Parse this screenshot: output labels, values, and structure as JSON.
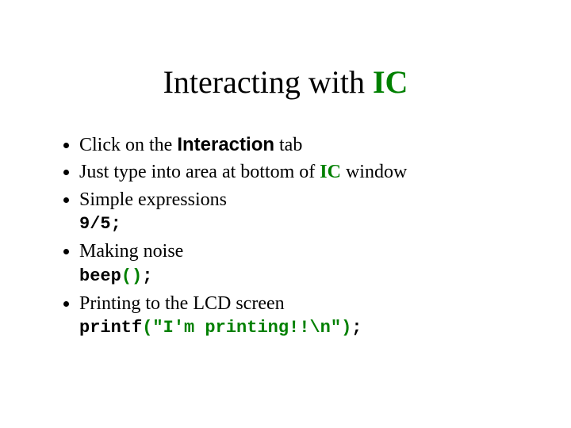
{
  "title": {
    "pre": "Interacting with ",
    "accent": "IC"
  },
  "b1": {
    "pre": "Click on the ",
    "strong": "Interaction",
    "post": " tab"
  },
  "b2a": "Just type into area at bottom of ",
  "b2b": "IC",
  "b2c": " window",
  "b3": "Simple expressions",
  "c1": "9/5;",
  "b4": "Making noise",
  "c2": {
    "fn": "beep",
    "lp": "(",
    "rp": ")",
    "semi": ";"
  },
  "b5": "Printing to the LCD screen",
  "c3": {
    "fn": "printf",
    "lp": "(",
    "arg": "\"I'm printing!!\\n\"",
    "rp": ")",
    "semi": ";"
  }
}
